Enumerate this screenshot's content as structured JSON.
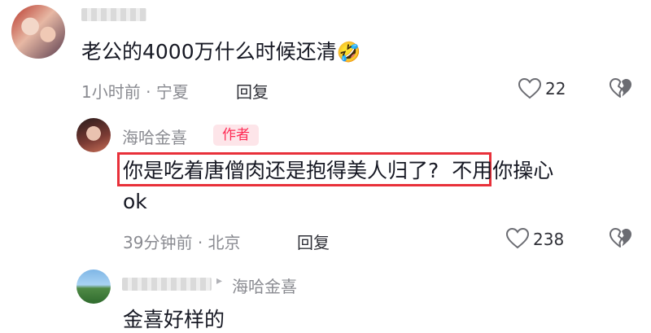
{
  "comments": [
    {
      "text": "老公的4000万什么时候还清",
      "emoji": "🤣",
      "time": "1小时前",
      "location": "宁夏",
      "reply_label": "回复",
      "likes": "22"
    },
    {
      "author": "海哈金喜",
      "badge": "作者",
      "line1_highlighted": "你是吃着唐僧肉还是抱得美人归了?",
      "line1_rest": "不用你操心",
      "line2": "ok",
      "time": "39分钟前",
      "location": "北京",
      "reply_label": "回复",
      "likes": "238"
    },
    {
      "reply_to": "海哈金喜",
      "text": "金喜好样的"
    }
  ],
  "separator": "·",
  "reply_arrow": "▸",
  "colors": {
    "accent": "#fe2c55",
    "highlight_border": "#e8303a",
    "meta": "#8a8b91"
  },
  "icons": {
    "like": "heart-outline-icon",
    "dislike": "broken-heart-icon"
  }
}
